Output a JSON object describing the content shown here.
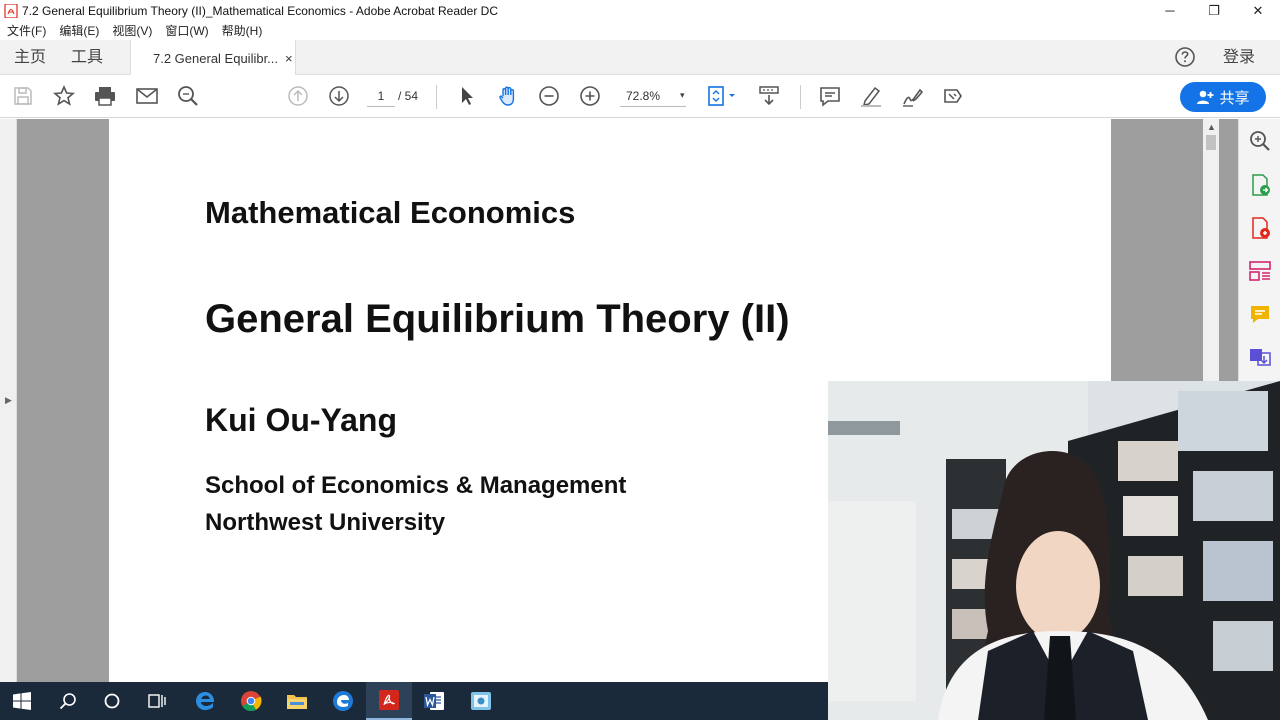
{
  "window": {
    "title": "7.2 General Equilibrium Theory (II)_Mathematical Economics - Adobe Acrobat Reader DC",
    "controls": {
      "minimize": "─",
      "restore": "❐",
      "close": "✕"
    }
  },
  "menu": {
    "items": [
      "文件(F)",
      "编辑(E)",
      "视图(V)",
      "窗口(W)",
      "帮助(H)"
    ]
  },
  "tabs": {
    "home": "主页",
    "tools": "工具",
    "document": "7.2 General Equilibr...",
    "close": "×",
    "login": "登录"
  },
  "toolbar": {
    "page_current": "1",
    "page_total": "/ 54",
    "zoom": "72.8%",
    "zoom_caret": "▾",
    "share_label": "共享"
  },
  "document": {
    "course": "Mathematical Economics",
    "lecture": "General Equilibrium Theory (II)",
    "author": "Kui Ou-Yang",
    "school": "School of Economics & Management",
    "university": "Northwest University"
  },
  "gutter": {
    "expand": "▶",
    "scroll_up": "▲"
  },
  "colors": {
    "accent": "#1473e6",
    "acrobat_red": "#e0281d",
    "canvas_gray": "#9e9e9e",
    "taskbar": "#1b2a3b"
  },
  "icons": {
    "toolbar": [
      "save-icon",
      "bookmark-star-icon",
      "print-icon",
      "email-icon",
      "search-icon",
      "page-up-icon",
      "page-down-icon",
      "select-cursor-icon",
      "hand-tool-icon",
      "zoom-out-icon",
      "zoom-in-icon",
      "fit-page-icon",
      "scroll-mode-icon",
      "comment-icon",
      "highlight-icon",
      "sign-icon",
      "more-tools-icon"
    ],
    "right_pane": [
      "zoom-search-icon",
      "export-pdf-icon",
      "create-pdf-icon",
      "organize-pages-icon",
      "comment-note-icon",
      "send-for-review-icon"
    ],
    "taskbar": [
      "windows-start-icon",
      "taskbar-search-icon",
      "cortana-icon",
      "task-view-icon",
      "edge-icon",
      "chrome-icon",
      "file-explorer-icon",
      "edge-alt-icon",
      "acrobat-icon",
      "word-icon",
      "screen-recorder-icon"
    ]
  }
}
